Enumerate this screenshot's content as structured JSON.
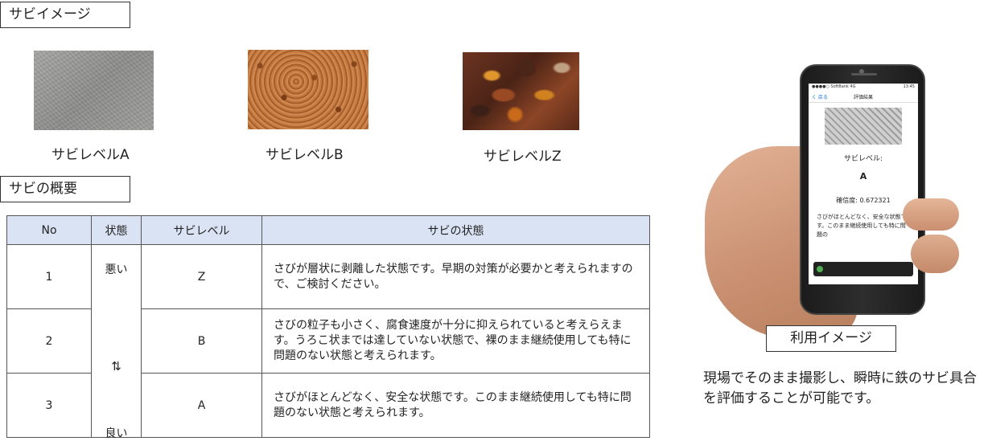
{
  "sections": {
    "image_title": "サビイメージ",
    "overview_title": "サビの概要",
    "usage_title": "利用イメージ"
  },
  "samples": [
    {
      "label": "サビレベルA",
      "image": "smooth-gray-surface"
    },
    {
      "label": "サビレベルB",
      "image": "fine-orange-rust"
    },
    {
      "label": "サビレベルZ",
      "image": "flaking-heavy-rust"
    }
  ],
  "table": {
    "headers": [
      "No",
      "状態",
      "サビレベル",
      "サビの状態"
    ],
    "state_labels": {
      "top": "悪い",
      "middle": "⇅",
      "bottom": "良い"
    },
    "rows": [
      {
        "no": "1",
        "level": "Z",
        "desc": "さびが層状に剥離した状態です。早期の対策が必要かと考えられますので、ご検討ください。"
      },
      {
        "no": "2",
        "level": "B",
        "desc": "さびの粒子も小さく、腐食速度が十分に抑えられていると考えらえます。うろこ状までは達していない状態で、裸のまま継続使用しても特に問題のない状態と考えられます。"
      },
      {
        "no": "3",
        "level": "A",
        "desc": "さびがほとんどなく、安全な状態です。このまま継続使用しても特に問題のない状態と考えられます。"
      }
    ]
  },
  "phone": {
    "carrier": "●●●●○ SoftBank 4G",
    "time": "13:45",
    "back_label": "く 戻る",
    "screen_title": "評価結果",
    "level_label": "サビレベル:",
    "level_value": "A",
    "confidence": "確信度: 0.672321",
    "description": "さびがほとんどなく、安全な状態です。このまま継続使用しても特に問題の"
  },
  "usage_description": "現場でそのまま撮影し、瞬時に鉄のサビ具合を評価することが可能です。",
  "colors": {
    "header_bg": "#dae3f3",
    "border": "#555555"
  }
}
